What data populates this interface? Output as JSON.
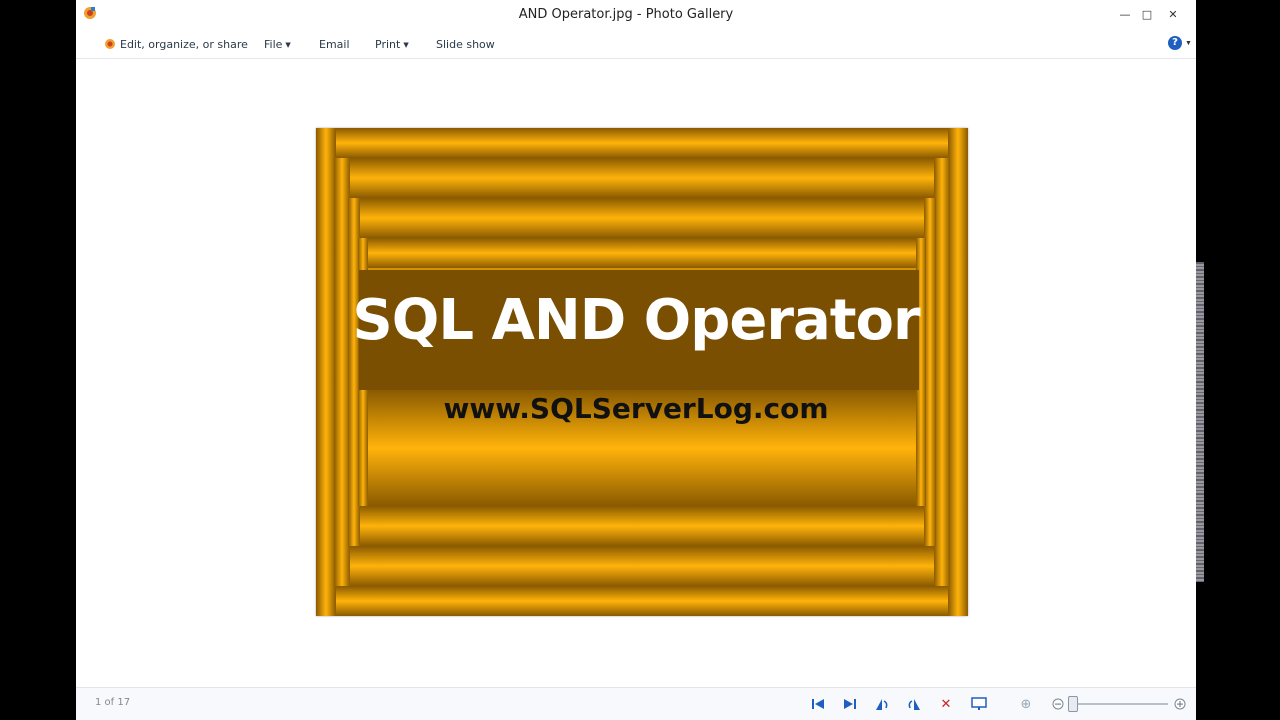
{
  "window": {
    "title": "AND Operator.jpg - Photo Gallery",
    "controls": {
      "minimize": "—",
      "maximize": "□",
      "close": "✕"
    }
  },
  "commandbar": {
    "edit_label": "Edit, organize, or share",
    "file_label": "File",
    "email_label": "Email",
    "print_label": "Print",
    "slideshow_label": "Slide show",
    "help_label": "?"
  },
  "photo": {
    "title": "SQL AND Operator",
    "url": "www.SQLServerLog.com",
    "colors": {
      "gold": "#f6a900",
      "dark": "#7a4f02"
    }
  },
  "statusbar": {
    "counter": "1 of 17",
    "buttons": {
      "first": "⏮",
      "next": "⏭",
      "rotate_left": "↶",
      "rotate_right": "↷",
      "delete": "✕",
      "slideshow": "▭",
      "actual_size": "⊕",
      "zoom_out": "−",
      "zoom_in": "+"
    }
  }
}
